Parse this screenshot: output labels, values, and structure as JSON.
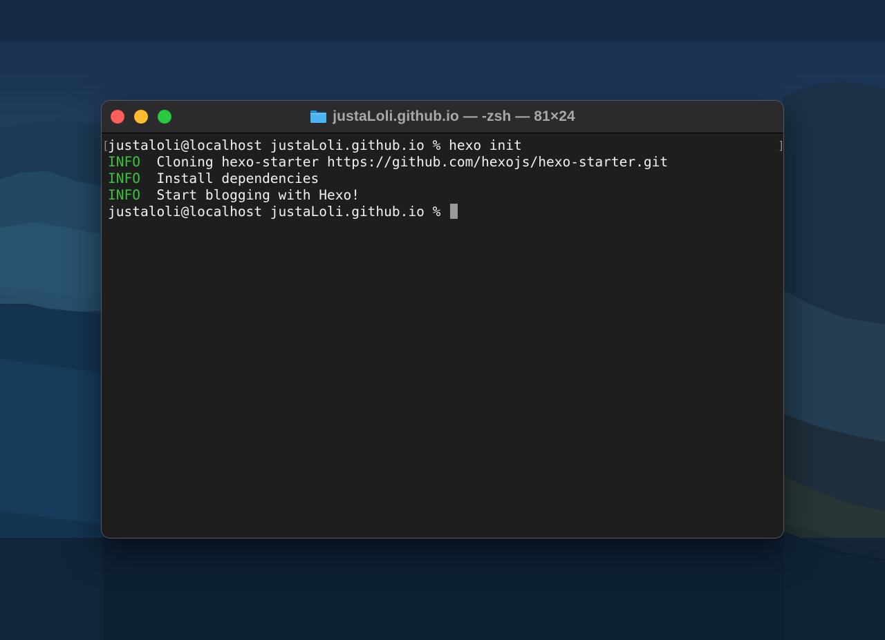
{
  "window": {
    "title": "justaLoli.github.io — -zsh — 81×24",
    "title_icon": "folder-icon"
  },
  "terminal": {
    "command_line": {
      "prompt": "justaloli@localhost justaLoli.github.io % ",
      "command": "hexo init"
    },
    "output": [
      {
        "tag": "INFO",
        "text": "  Cloning hexo-starter https://github.com/hexojs/hexo-starter.git"
      },
      {
        "tag": "INFO",
        "text": "  Install dependencies"
      },
      {
        "tag": "INFO",
        "text": "  Start blogging with Hexo!"
      }
    ],
    "current_prompt": "justaloli@localhost justaLoli.github.io % ",
    "mark_open": "[",
    "mark_close": "]"
  },
  "colors": {
    "info_tag": "#3dc23d",
    "text": "#f2f2f2",
    "background": "#1e1e1e",
    "close": "#fe5f57",
    "minimize": "#febc2e",
    "zoom": "#28c840"
  }
}
